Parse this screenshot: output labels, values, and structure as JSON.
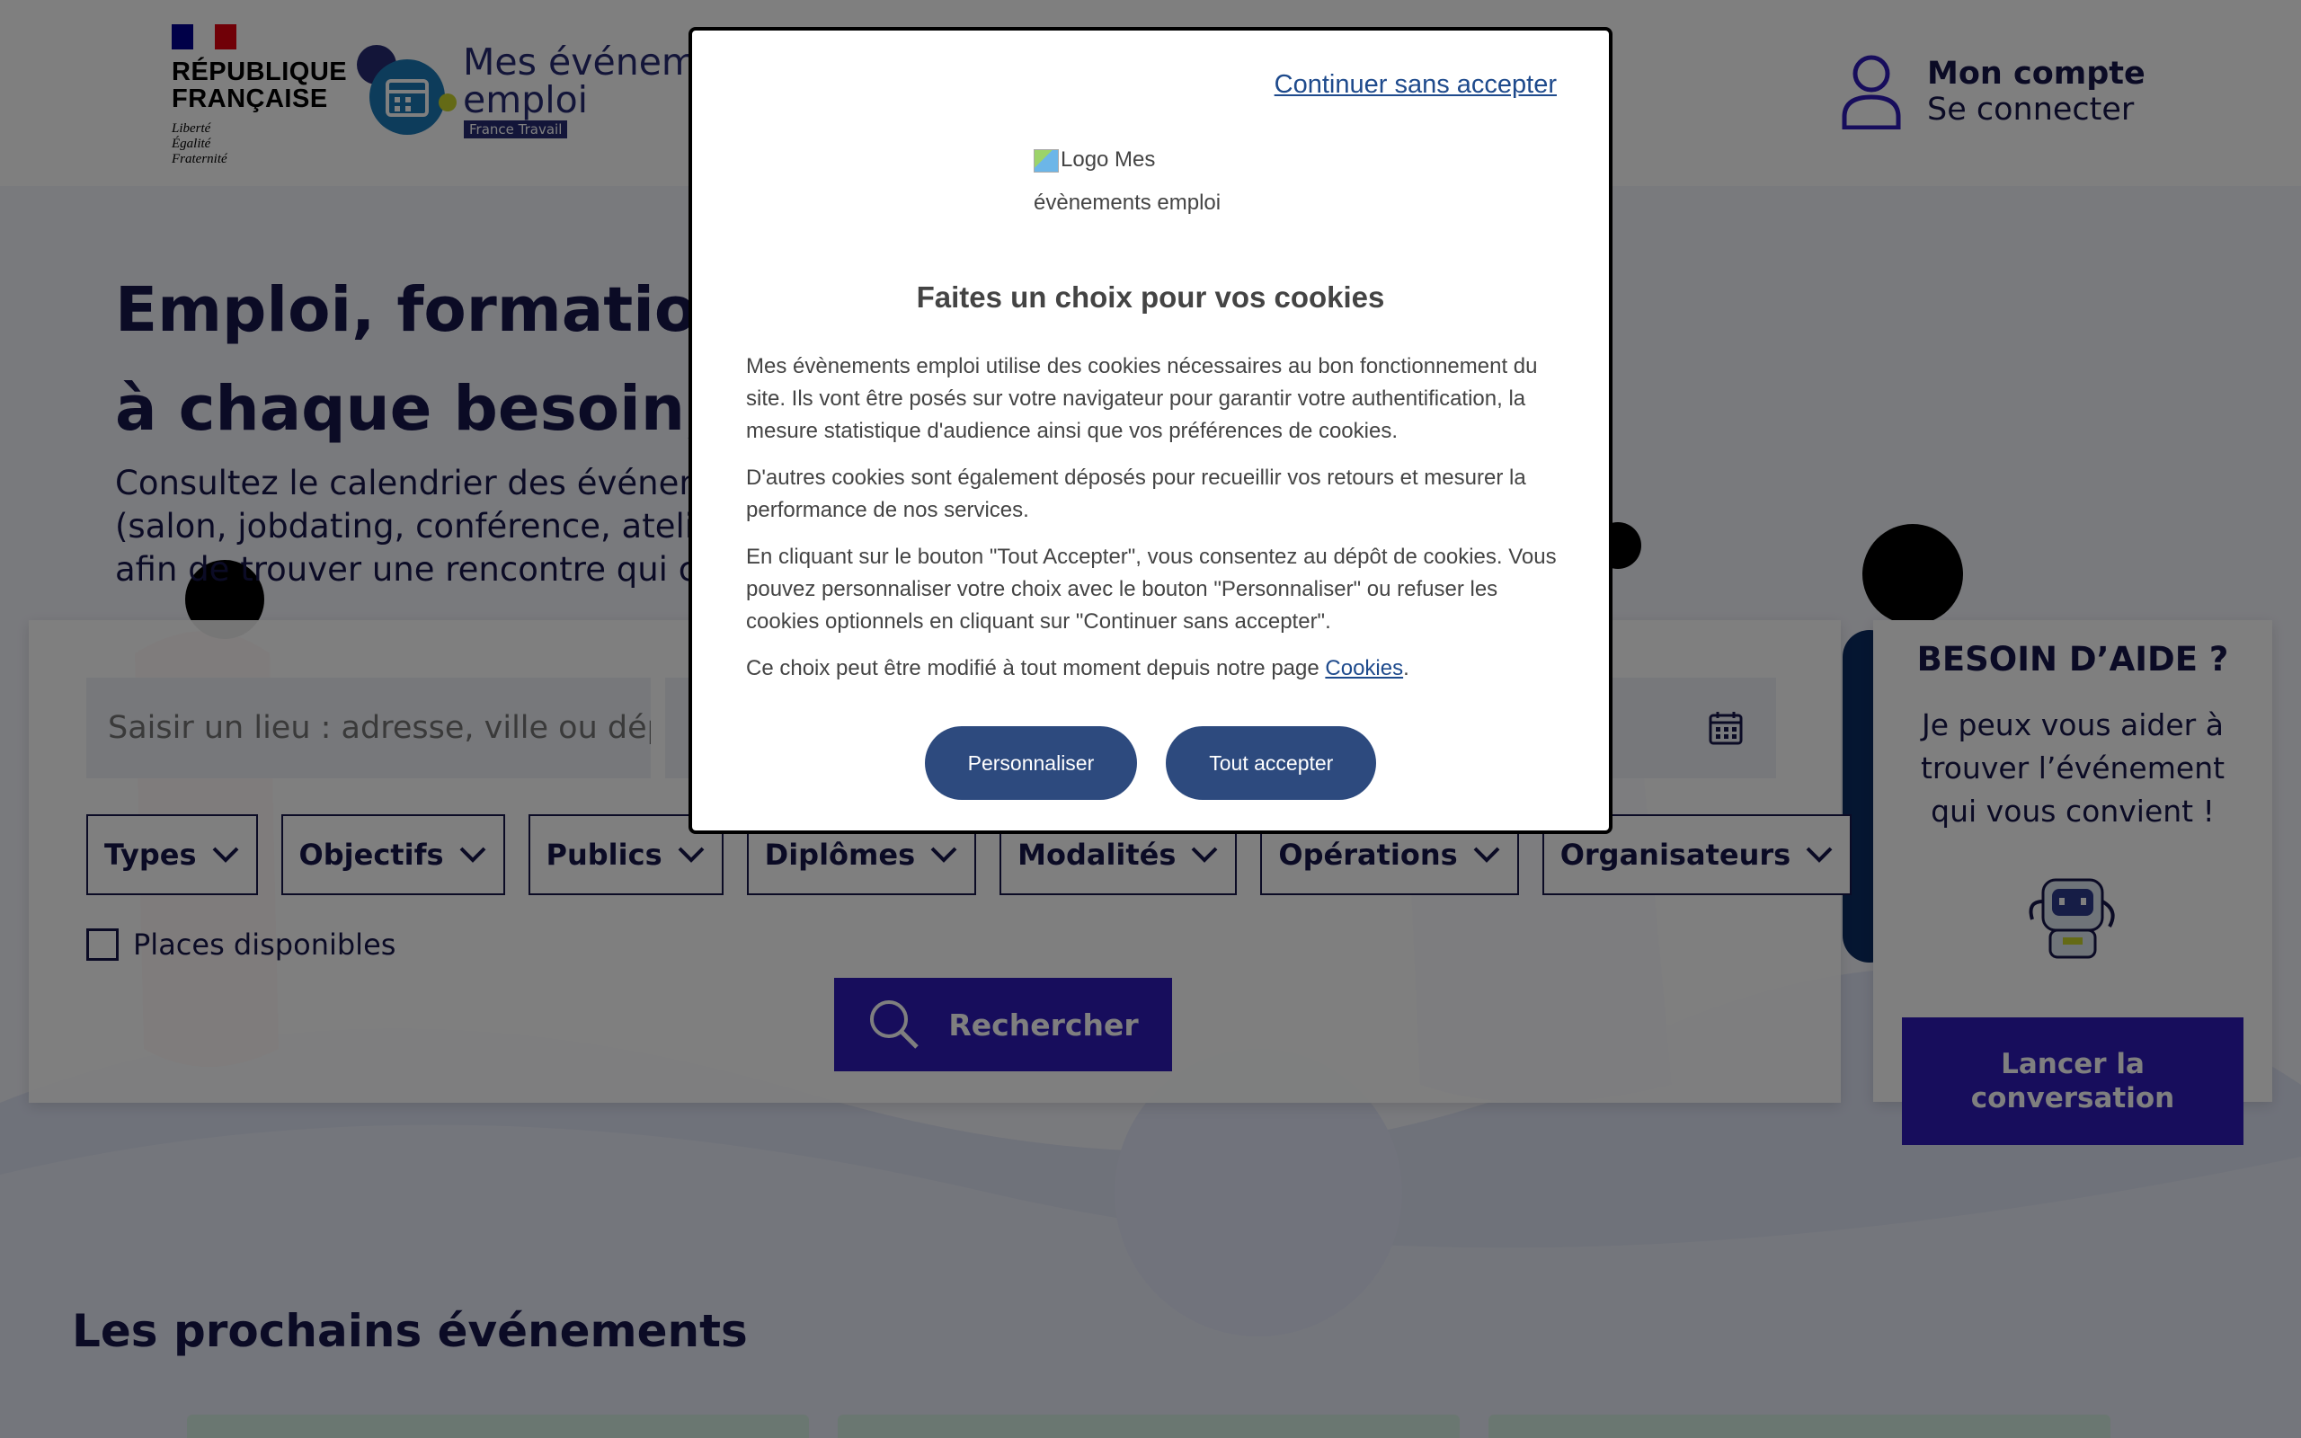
{
  "header": {
    "rf_title_line1": "RÉPUBLIQUE",
    "rf_title_line2": "FRANÇAISE",
    "rf_motto_1": "Liberté",
    "rf_motto_2": "Égalité",
    "rf_motto_3": "Fraternité",
    "site_name_line1": "Mes événements",
    "site_name_line2": "emploi",
    "site_tag": "France Travail",
    "account_title": "Mon compte",
    "account_sub": "Se connecter"
  },
  "hero": {
    "title_line1": "Emploi, formation,",
    "title_line2": "à chaque besoin, u",
    "sub_line1": "Consultez le calendrier des événem",
    "sub_line2": "(salon, jobdating, conférence, atelie",
    "sub_line3": "afin de trouver une rencontre qui co"
  },
  "search": {
    "place_placeholder": "Saisir un lieu : adresse, ville ou dép…",
    "filters": [
      "Types",
      "Objectifs",
      "Publics",
      "Diplômes",
      "Modalités",
      "Opérations",
      "Organisateurs"
    ],
    "places_label": "Places disponibles",
    "search_button": "Rechercher"
  },
  "help": {
    "title": "BESOIN D’AIDE ?",
    "text": "Je peux vous aider à trouver l’événement qui vous convient !",
    "button": "Lancer la conversation"
  },
  "events": {
    "title": "Les prochains événements"
  },
  "cookie_modal": {
    "skip": "Continuer sans accepter",
    "logo_alt": "Logo Mes évènements emploi",
    "title": "Faites un choix pour vos cookies",
    "p1": "Mes évènements emploi utilise des cookies nécessaires au bon fonctionnement du site. Ils vont être posés sur votre navigateur pour garantir votre authentification, la mesure statistique d'audience ainsi que vos préférences de cookies.",
    "p2": "D'autres cookies sont également déposés pour recueillir vos retours et mesurer la performance de nos services.",
    "p3": "En cliquant sur le bouton \"Tout Accepter\", vous consentez au dépôt de cookies. Vous pouvez personnaliser votre choix avec le bouton \"Personnaliser\" ou refuser les cookies optionnels en cliquant sur \"Continuer sans accepter\".",
    "p4_prefix": "Ce choix peut être modifié à tout moment depuis notre page ",
    "p4_link": "Cookies",
    "p4_suffix": ".",
    "btn_customize": "Personnaliser",
    "btn_accept": "Tout accepter"
  },
  "colors": {
    "brand_navy": "#16164b",
    "primary_button": "#2f1ab8",
    "modal_button": "#2d4a7e",
    "overlay": "rgba(0,0,0,0.5)"
  },
  "icons": [
    "user-icon",
    "calendar-icon",
    "chevron-down-icon",
    "search-icon",
    "robot-icon",
    "marianne-flag-icon"
  ]
}
